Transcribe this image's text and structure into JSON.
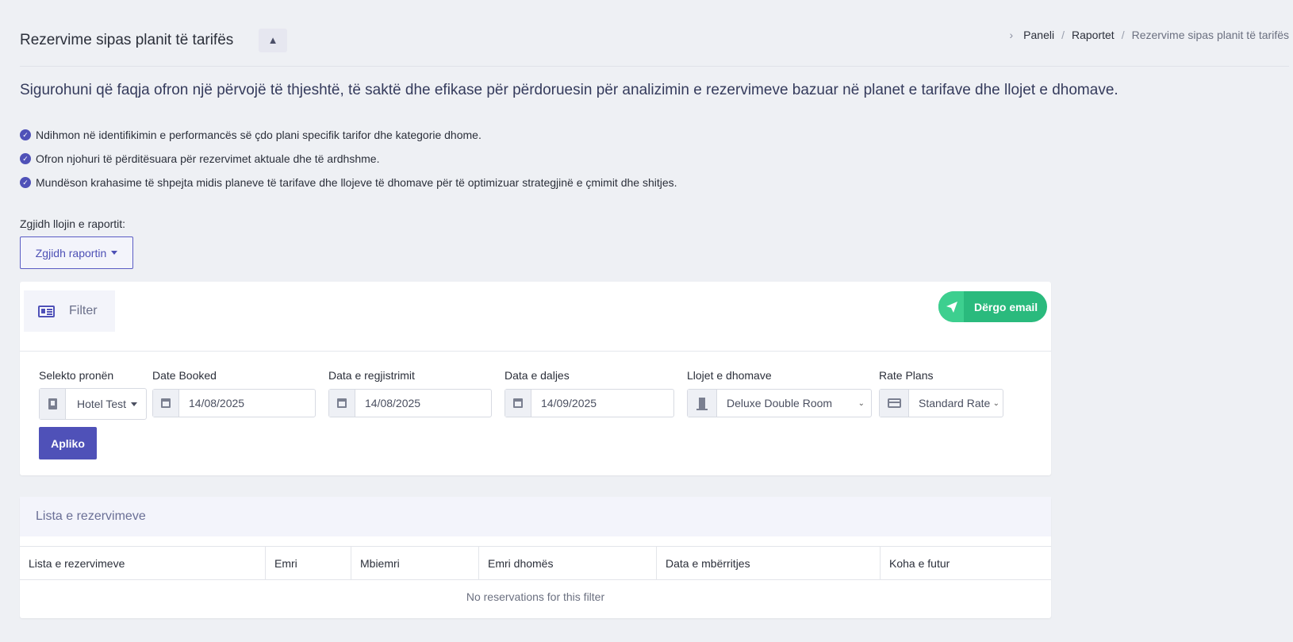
{
  "header": {
    "title": "Rezervime sipas planit të tarifës",
    "collapse_icon": "▲",
    "breadcrumb": [
      "Paneli",
      "Raportet",
      "Rezervime sipas planit të tarifës"
    ]
  },
  "intro": {
    "lead": "Sigurohuni që faqja ofron një përvojë të thjeshtë, të saktë dhe efikase për përdoruesin për analizimin e rezervimeve bazuar në planet e tarifave dhe llojet e dhomave.",
    "bullets": [
      "Ndihmon në identifikimin e performancës së çdo plani specifik tarifor dhe kategorie dhome.",
      "Ofron njohuri të përditësuara për rezervimet aktuale dhe të ardhshme.",
      "Mundëson krahasime të shpejta midis planeve të tarifave dhe llojeve të dhomave për të optimizuar strategjinë e çmimit dhe shitjes."
    ]
  },
  "report": {
    "label": "Zgjidh llojin e raportit:",
    "button": "Zgjidh raportin"
  },
  "filter": {
    "tab_label": "Filter",
    "email_button": "Dërgo email",
    "fields": {
      "property": {
        "label": "Selekto pronën",
        "value": "Hotel Test"
      },
      "date_booked": {
        "label": "Date Booked",
        "value": "14/08/2025"
      },
      "checkin": {
        "label": "Data e regjistrimit",
        "value": "14/08/2025"
      },
      "checkout": {
        "label": "Data e daljes",
        "value": "14/09/2025"
      },
      "room_types": {
        "label": "Llojet e dhomave",
        "value": "Deluxe Double Room"
      },
      "rate_plans": {
        "label": "Rate Plans",
        "value": "Standard Rate"
      }
    },
    "apply_button": "Apliko"
  },
  "reservations": {
    "title": "Lista e rezervimeve",
    "columns": [
      "Lista e rezervimeve",
      "Emri",
      "Mbiemri",
      "Emri dhomës",
      "Data e mbërritjes",
      "Koha e futur"
    ],
    "empty_message": "No reservations for this filter"
  },
  "colors": {
    "primary": "#4f51b8",
    "success": "#2aba7d",
    "background": "#eef0f4"
  }
}
